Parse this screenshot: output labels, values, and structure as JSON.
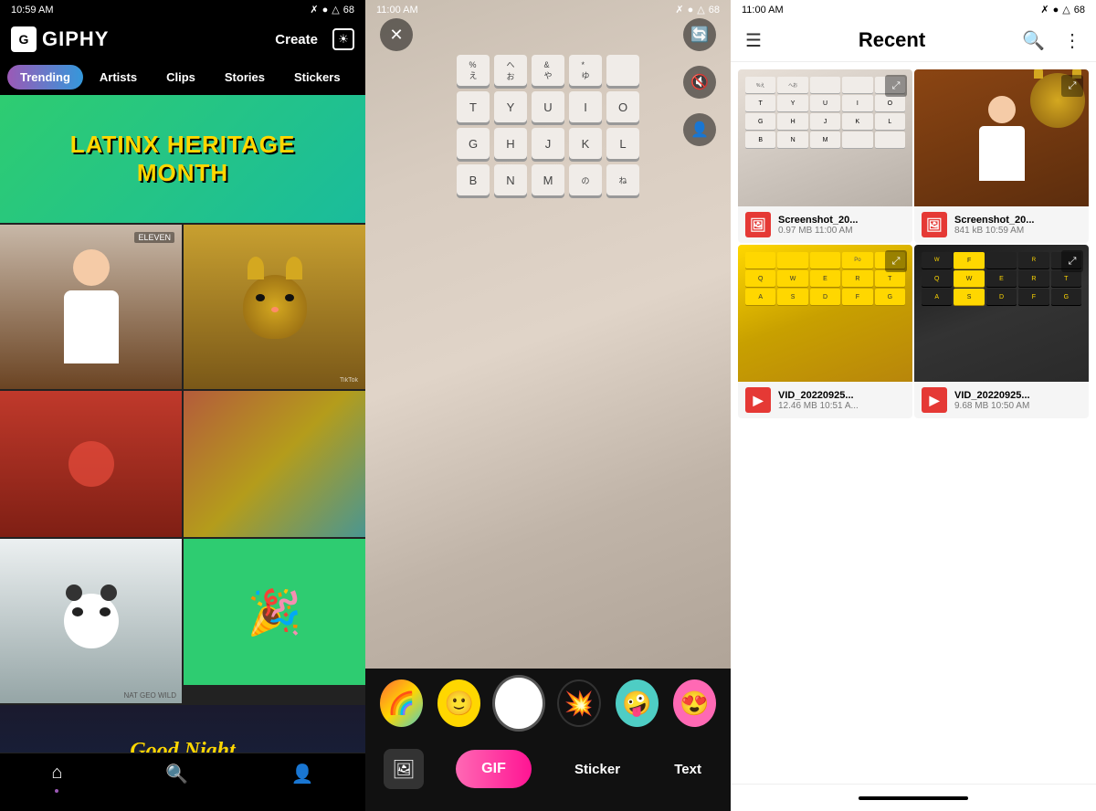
{
  "panel1": {
    "status": {
      "time": "10:59 AM",
      "icons": [
        "notification",
        "wifi",
        "battery"
      ]
    },
    "logo": "GIPHY",
    "header": {
      "create_label": "Create"
    },
    "nav": {
      "items": [
        {
          "label": "Trending",
          "active": true
        },
        {
          "label": "Artists",
          "active": false
        },
        {
          "label": "Clips",
          "active": false
        },
        {
          "label": "Stories",
          "active": false
        },
        {
          "label": "Stickers",
          "active": false
        }
      ]
    },
    "banner": {
      "text": "LATINX HERITAGE\nMONTH"
    },
    "bottom_nav": {
      "home_label": "Home",
      "search_label": "Search",
      "profile_label": "Profile"
    }
  },
  "panel2": {
    "status": {
      "time": "11:00 AM"
    },
    "controls": {
      "flip_camera": "flip",
      "mute": "mute",
      "portrait": "portrait"
    },
    "bottom_bar": {
      "gif_label": "GIF",
      "sticker_label": "Sticker",
      "text_label": "Text"
    }
  },
  "panel3": {
    "status": {
      "time": "11:00 AM"
    },
    "header": {
      "title": "Recent"
    },
    "files": [
      {
        "name": "Screenshot_20...",
        "meta": "0.97 MB  11:00 AM",
        "type": "screenshot",
        "thumb": "keyboard-white"
      },
      {
        "name": "Screenshot_20...",
        "meta": "841 kB  10:59 AM",
        "type": "screenshot",
        "thumb": "person"
      },
      {
        "name": "VID_20220925...",
        "meta": "12.46 MB  10:51 A...",
        "type": "video",
        "thumb": "keyboard-yellow"
      },
      {
        "name": "VID_20220925...",
        "meta": "9.68 MB  10:50 AM",
        "type": "video",
        "thumb": "keyboard-dark"
      }
    ]
  }
}
